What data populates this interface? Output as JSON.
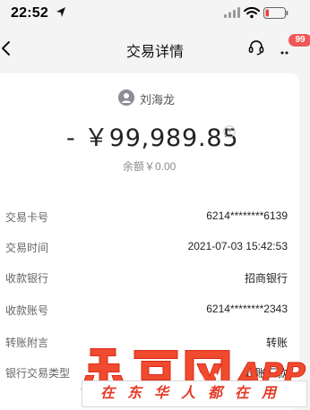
{
  "status_bar": {
    "time": "22:52",
    "icons": [
      "location-arrow-icon",
      "signal-icon",
      "wifi-icon",
      "battery-icon"
    ]
  },
  "nav": {
    "title": "交易详情",
    "badge": "99",
    "icons": [
      "back-icon",
      "customer-service-icon",
      "more-icon"
    ]
  },
  "transaction": {
    "payee": "刘海龙",
    "amount": "- ￥99,989.85",
    "balance": "余额￥0.00"
  },
  "details": [
    {
      "label": "交易卡号",
      "value": "6214********6139"
    },
    {
      "label": "交易时间",
      "value": "2021-07-03 15:42:53"
    },
    {
      "label": "收款银行",
      "value": "招商银行"
    },
    {
      "label": "收款账号",
      "value": "6214********2343"
    },
    {
      "label": "转账附言",
      "value": "转账"
    },
    {
      "label": "银行交易类型",
      "value": "转账汇款"
    }
  ],
  "watermark": {
    "logo_text": "东单网 APP",
    "slogan": "在东华人都在用"
  },
  "colors": {
    "accent_red": "#e53b27",
    "badge_red": "#f05858",
    "background": "#f4f4f4",
    "card": "#ffffff"
  }
}
